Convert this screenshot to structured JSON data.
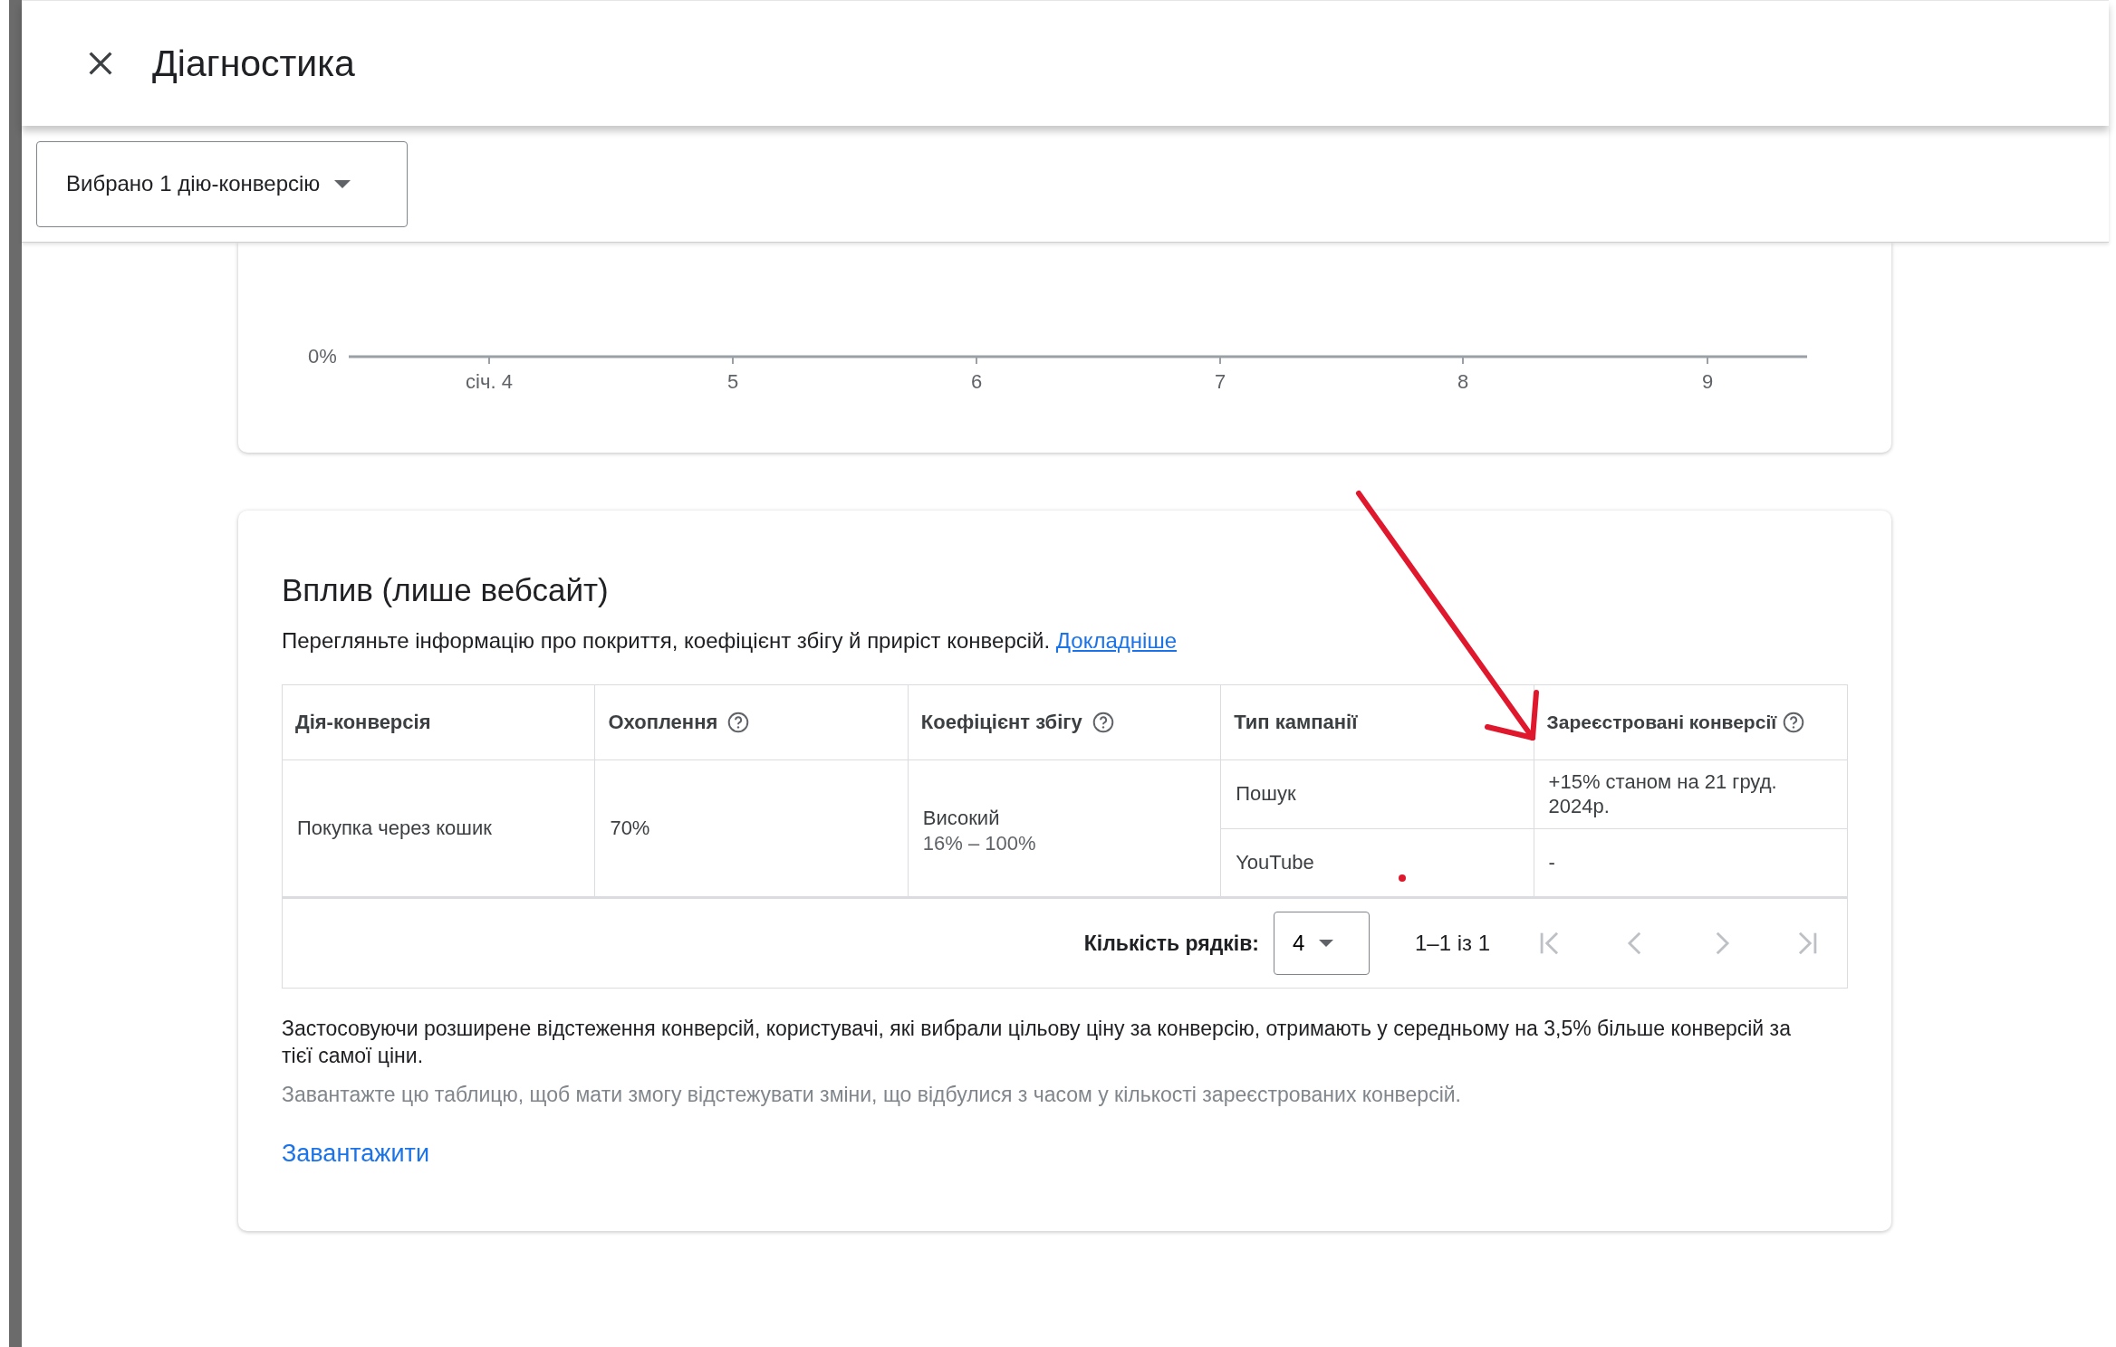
{
  "header": {
    "title": "Діагностика"
  },
  "toolbar": {
    "dropdown": {
      "label": "Вибрано 1 дію-конверсію"
    }
  },
  "chart_card": {
    "y_tick_label": "0%",
    "x_labels": [
      "січ. 4",
      "5",
      "6",
      "7",
      "8",
      "9"
    ]
  },
  "impact_card": {
    "title": "Вплив (лише вебсайт)",
    "description": "Перегляньте інформацію про покриття, коефіцієнт збігу й приріст конверсій.",
    "learn_more_link": "Докладніше",
    "table": {
      "columns": [
        {
          "label": "Дія-конверсія",
          "help": false
        },
        {
          "label": "Охоплення",
          "help": true
        },
        {
          "label": "Коефіцієнт збігу",
          "help": true
        },
        {
          "label": "Тип кампанії",
          "help": false
        },
        {
          "label": "Зареєстровані конверсії",
          "help": true
        }
      ],
      "rows": [
        {
          "conversion_action": "Покупка через кошик",
          "coverage": "70%",
          "match_rate": "Високий",
          "match_range": "16% – 100%",
          "campaigns": [
            {
              "type": "Пошук",
              "registered": "+15% станом на 21 груд. 2024р."
            },
            {
              "type": "YouTube",
              "registered": "-"
            }
          ]
        }
      ]
    },
    "pagination": {
      "rows_label": "Кількість рядків:",
      "rows_value": "4",
      "range": "1–1 із 1",
      "nav_buttons": [
        {
          "kind": "first",
          "disabled": true
        },
        {
          "kind": "prev",
          "disabled": true
        },
        {
          "kind": "next",
          "disabled": true
        },
        {
          "kind": "last",
          "disabled": true
        }
      ]
    },
    "summary": "Застосовуючи розширене відстеження конверсій, користувачі, які вибрали цільову ціну за конверсію, отримають у середньому на 3,5% більше конверсій за тієї самої ціни.",
    "download_hint": "Завантажте цю таблицю, щоб мати змогу відстежувати зміни, що відбулися з часом у кількості зареєстрованих конверсій.",
    "download_link": "Завантажити"
  }
}
